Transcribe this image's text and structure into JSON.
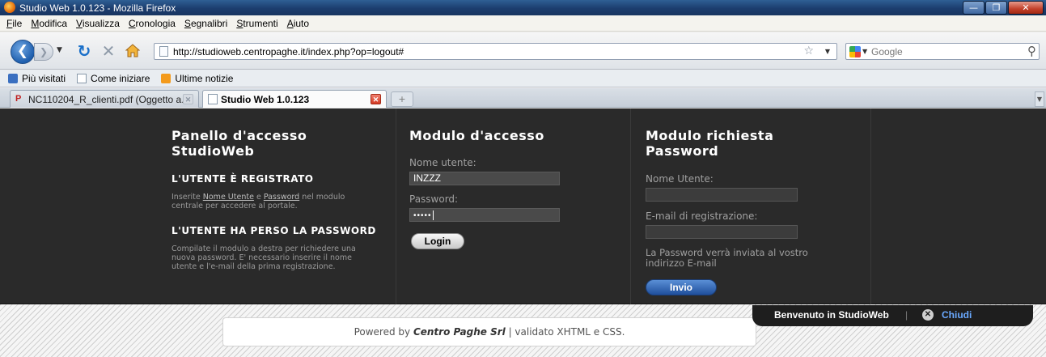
{
  "window": {
    "title": "Studio Web 1.0.123 - Mozilla Firefox"
  },
  "menu": [
    "File",
    "Modifica",
    "Visualizza",
    "Cronologia",
    "Segnalibri",
    "Strumenti",
    "Aiuto"
  ],
  "nav": {
    "url": "http://studioweb.centropaghe.it/index.php?op=logout#",
    "search_placeholder": "Google"
  },
  "bookmarks": [
    "Più visitati",
    "Come iniziare",
    "Ultime notizie"
  ],
  "tabs": [
    {
      "label": "NC110204_R_clienti.pdf (Oggetto a...",
      "active": false
    },
    {
      "label": "Studio Web 1.0.123",
      "active": true
    }
  ],
  "panel1": {
    "title_line1": "Panello d'accesso",
    "title_line2": "StudioWeb",
    "section1_title": "L'UTENTE È REGISTRATO",
    "section1_pre": "Inserite ",
    "section1_link1": "Nome Utente",
    "section1_mid": " e ",
    "section1_link2": "Password",
    "section1_post": " nel modulo",
    "section1_line2": "centrale per accedere al portale.",
    "section2_title": "L'UTENTE HA PERSO LA PASSWORD",
    "section2_line1": "Compilate il modulo a destra per richiedere una",
    "section2_line2": "nuova password. E' necessario inserire il nome",
    "section2_line3": "utente e l'e-mail della prima registrazione."
  },
  "login": {
    "title": "Modulo d'accesso",
    "username_label": "Nome utente:",
    "username_value": "INZZZ",
    "password_label": "Password:",
    "password_value": "•••••",
    "button": "Login"
  },
  "recover": {
    "title_line1": "Modulo richiesta",
    "title_line2": "Password",
    "username_label": "Nome Utente:",
    "email_label": "E-mail di registrazione:",
    "info_line1": "La Password verrà inviata al vostro",
    "info_line2": "indirizzo E-mail",
    "button": "Invio"
  },
  "footer": {
    "prefix": "Powered by ",
    "brand": "Centro Paghe Srl",
    "suffix": " | validato XHTML e CSS."
  },
  "welcome_bar": {
    "text": "Benvenuto in StudioWeb",
    "separator": "|",
    "close_label": "Chiudi"
  }
}
